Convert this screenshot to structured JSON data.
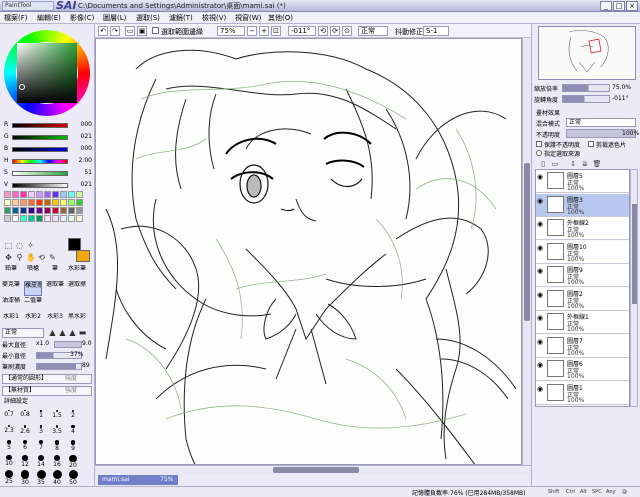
{
  "app": {
    "logo_text": "PaintTool",
    "name": "SAI",
    "window_title": "C:\\Documents and Settings\\Administrator\\桌面\\mami.sai (*)",
    "buttons": [
      "_",
      "□",
      "×"
    ]
  },
  "menu": [
    "檔案(F)",
    "編輯(E)",
    "影像(C)",
    "圖層(L)",
    "選取(S)",
    "濾鏡(T)",
    "檢視(V)",
    "視窗(W)",
    "其他(O)"
  ],
  "toolbar": {
    "selection_label": "選取範圍邊緣",
    "zoom": "75%",
    "angle": "-011°",
    "mode": "正常",
    "stabilizer_label": "抖動修正",
    "stabilizer": "S-1"
  },
  "color": {
    "wheel_icon": "color-wheel",
    "sliders": [
      {
        "label": "R",
        "value": "000",
        "color": "#e00000"
      },
      {
        "label": "G",
        "value": "021",
        "color": "#00c000"
      },
      {
        "label": "B",
        "value": "000",
        "color": "#0000e0"
      },
      {
        "label": "H",
        "value": "2.00",
        "color": "#ff00ff"
      },
      {
        "label": "S",
        "value": "51",
        "color": "#888888"
      },
      {
        "label": "V",
        "value": "021",
        "color": "#444444"
      }
    ],
    "foreground": "#000000",
    "background": "#f3a50c",
    "swatches": [
      "#ff99cc",
      "#ff66cc",
      "#ff33aa",
      "#ffccff",
      "#cc99ff",
      "#9966ff",
      "#6633ff",
      "#99ccff",
      "#66ffff",
      "#ccff99",
      "#ffffcc",
      "#ffcc99",
      "#ff9966",
      "#ff6633",
      "#ff3300",
      "#cc6600",
      "#ffcc00",
      "#ffff66",
      "#99ff66",
      "#33cc33",
      "#339966",
      "#006699",
      "#003399",
      "#330099",
      "#660099",
      "#990066",
      "#cc0033",
      "#996633",
      "#666666",
      "#999999",
      "#cccccc",
      "#ffffff",
      "#33ffcc",
      "#00cc99",
      "#009966",
      "#ffe0f0",
      "#f0e0ff",
      "#e0f0ff",
      "#e0ffe0",
      "#fff0e0"
    ]
  },
  "tools": {
    "row1": [
      "鉛筆",
      "噴槍",
      "筆",
      "水彩筆"
    ],
    "row2": [
      "麥克筆",
      "橡皮擦",
      "選取筆",
      "選取擦"
    ],
    "row3": [
      "油漆桶",
      "二值筆"
    ],
    "row4": [
      "水彩1",
      "水彩2",
      "水彩3",
      "黑水彩"
    ]
  },
  "brush": {
    "mode": "正常",
    "max_size_label": "最大直徑",
    "max_size_mult": "x1.0",
    "max_size": "9.0",
    "min_size_label": "最小直徑",
    "min_size": "37%",
    "density_label": "筆刷濃度",
    "density": "89",
    "shape_label": "【通常的圓形】",
    "shape_strength": "強度",
    "texture_label": "【無材質】",
    "texture_strength": "強度",
    "detail_label": "詳細設定"
  },
  "brush_sizes": [
    "0.7",
    "0.8",
    "1",
    "1.5",
    "2",
    "2.3",
    "2.6",
    "3",
    "3.5",
    "4",
    "5",
    "6",
    "7",
    "8",
    "9",
    "10",
    "12",
    "14",
    "16",
    "20",
    "25",
    "30",
    "35",
    "40",
    "50"
  ],
  "document": {
    "name": "mami.sai",
    "zoom": "75%"
  },
  "navigator": {
    "zoom_label": "縮放倍率",
    "zoom": "75.0%",
    "angle_label": "旋轉角度",
    "angle": "-011°"
  },
  "layer_panel": {
    "title": "畫材效果",
    "blend_label": "混合模式",
    "blend_value": "正常",
    "opacity_label": "不透明度",
    "opacity": "100%",
    "preserve_label": "保護不透明度",
    "clip_label": "剪裁遮色片",
    "select_source_label": "指定選取來源"
  },
  "layers": [
    {
      "name": "圖層5",
      "mode": "正常",
      "opacity": "100%",
      "selected": false
    },
    {
      "name": "圖層3",
      "mode": "正常",
      "opacity": "100%",
      "selected": true
    },
    {
      "name": "外框線2",
      "mode": "正常",
      "opacity": "100%",
      "selected": false
    },
    {
      "name": "圖層10",
      "mode": "正常",
      "opacity": "100%",
      "selected": false
    },
    {
      "name": "圖層9",
      "mode": "正常",
      "opacity": "100%",
      "selected": false
    },
    {
      "name": "圖層2",
      "mode": "正常",
      "opacity": "100%",
      "selected": false
    },
    {
      "name": "外框線1",
      "mode": "正常",
      "opacity": "100%",
      "selected": false
    },
    {
      "name": "圖層7",
      "mode": "正常",
      "opacity": "100%",
      "selected": false
    },
    {
      "name": "圖層6",
      "mode": "正常",
      "opacity": "100%",
      "selected": false
    },
    {
      "name": "圖層1",
      "mode": "正常",
      "opacity": "100%",
      "selected": false
    }
  ],
  "status": {
    "memory": "記憶體負載率:76% (已用284MB/358MB)",
    "keys": [
      "Shift",
      "Ctrl",
      "Alt",
      "SPC",
      "Any",
      "@"
    ]
  }
}
